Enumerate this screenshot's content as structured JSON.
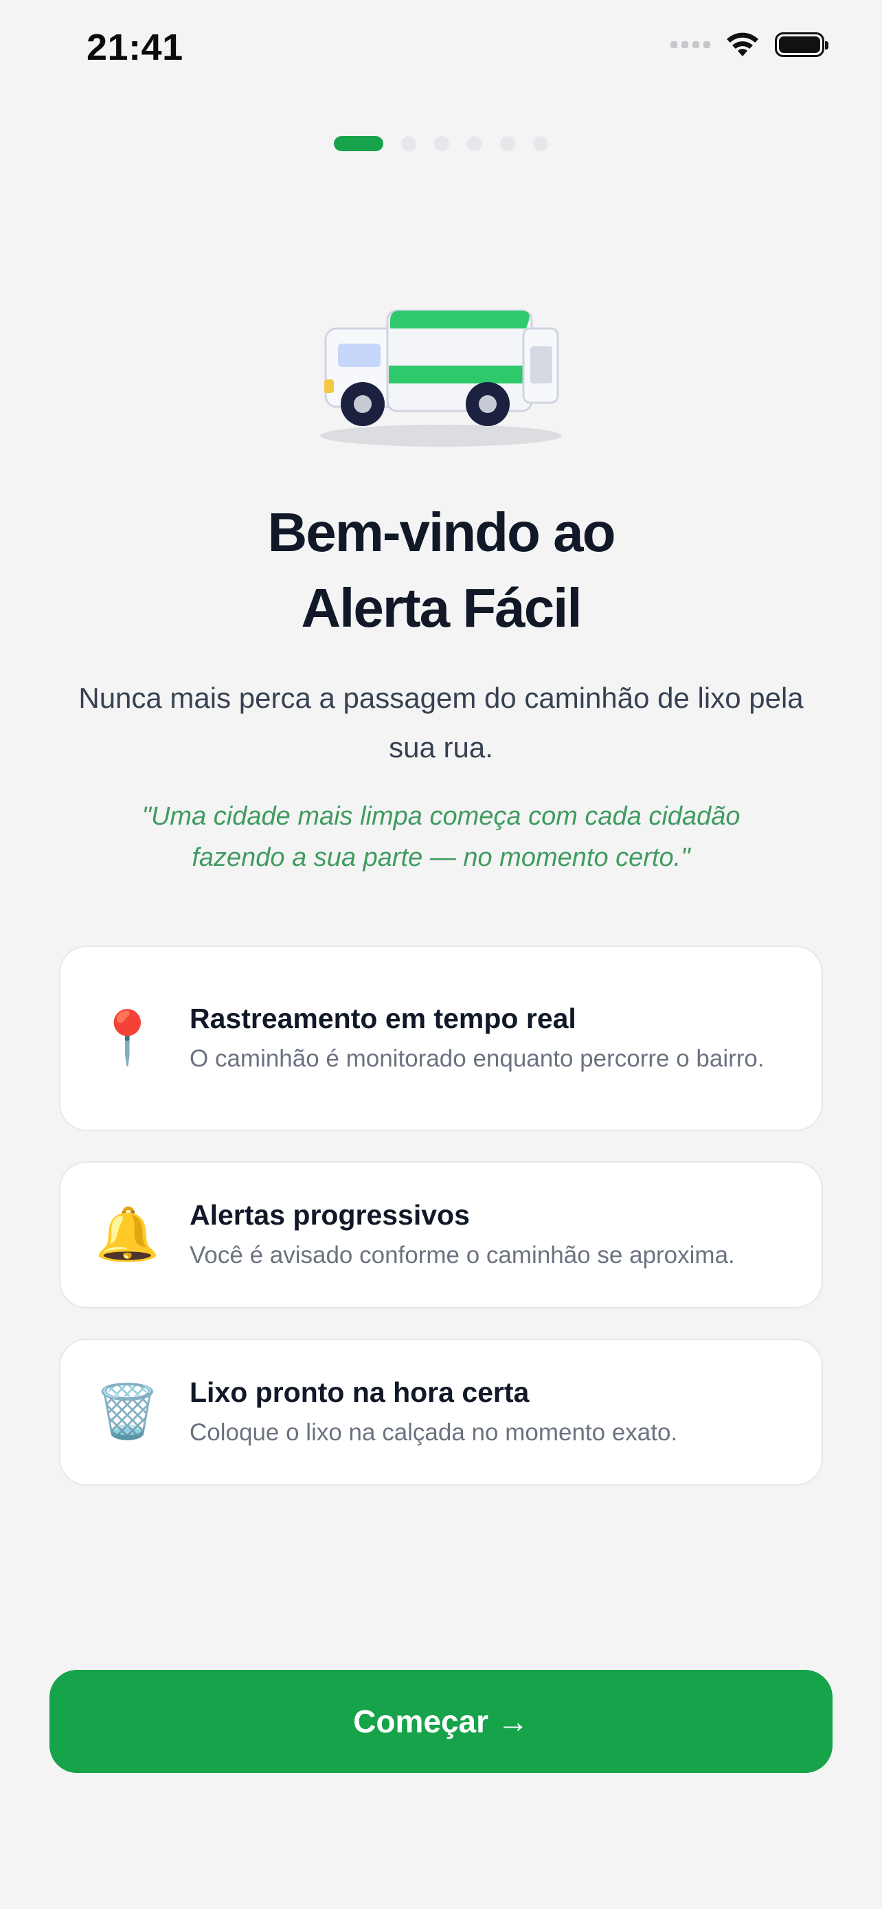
{
  "status_bar": {
    "time": "21:41"
  },
  "pager": {
    "total": 6,
    "active_index": 0
  },
  "hero": {
    "title_line1": "Bem-vindo ao",
    "title_line2": "Alerta Fácil",
    "subtitle": "Nunca mais perca a passagem do caminhão de lixo pela sua rua.",
    "quote": "\"Uma cidade mais limpa começa com cada cidadão fazendo a sua parte — no momento certo.\""
  },
  "features": [
    {
      "icon": "📍",
      "icon_name": "pin-icon",
      "title": "Rastreamento em tempo real",
      "description": "O caminhão é monitorado enquanto percorre o bairro."
    },
    {
      "icon": "🔔",
      "icon_name": "bell-icon",
      "title": "Alertas progressivos",
      "description": "Você é avisado conforme o caminhão se aproxima."
    },
    {
      "icon": "🗑️",
      "icon_name": "trash-can-icon",
      "title": "Lixo pronto na hora certa",
      "description": "Coloque o lixo na calçada no momento exato."
    }
  ],
  "cta": {
    "label": "Começar →"
  },
  "colors": {
    "accent": "#16a34a",
    "background": "#f4f4f5",
    "quote": "#3f9b5f"
  }
}
